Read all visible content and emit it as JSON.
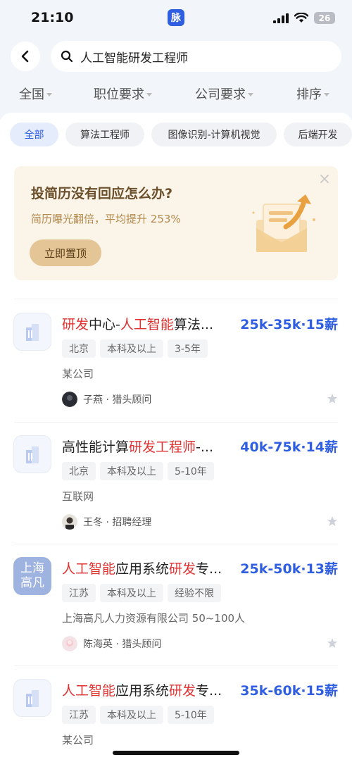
{
  "status_bar": {
    "time": "21:10",
    "app_badge": "脉",
    "battery": "26"
  },
  "search": {
    "query": "人工智能研发工程师"
  },
  "filters": [
    {
      "label": "全国"
    },
    {
      "label": "职位要求"
    },
    {
      "label": "公司要求"
    },
    {
      "label": "排序"
    }
  ],
  "chips": [
    {
      "label": "全部",
      "active": true
    },
    {
      "label": "算法工程师"
    },
    {
      "label": "图像识别-计算机视觉"
    },
    {
      "label": "后端开发"
    }
  ],
  "promo": {
    "title": "投简历没有回应怎么办?",
    "subtitle": "简历曝光翻倍，平均提升 253%",
    "button": "立即置顶"
  },
  "jobs": [
    {
      "title_parts": [
        {
          "t": "研发",
          "hl": true
        },
        {
          "t": "中心-",
          "hl": false
        },
        {
          "t": "人工智能",
          "hl": true
        },
        {
          "t": "算法...",
          "hl": false
        }
      ],
      "salary": "25k-35k·15薪",
      "tags": [
        "北京",
        "本科及以上",
        "3-5年"
      ],
      "company": "某公司",
      "recruiter": "子燕 · 猎头顾问",
      "logo_text": ""
    },
    {
      "title_parts": [
        {
          "t": "高性能计算",
          "hl": false
        },
        {
          "t": "研发工程师",
          "hl": true
        },
        {
          "t": "-...",
          "hl": false
        }
      ],
      "salary": "40k-75k·14薪",
      "tags": [
        "北京",
        "本科及以上",
        "5-10年"
      ],
      "company": "互联网",
      "recruiter": "王冬 · 招聘经理",
      "logo_text": ""
    },
    {
      "title_parts": [
        {
          "t": "人工智能",
          "hl": true
        },
        {
          "t": "应用系统",
          "hl": false
        },
        {
          "t": "研发",
          "hl": true
        },
        {
          "t": "专...",
          "hl": false
        }
      ],
      "salary": "25k-50k·13薪",
      "tags": [
        "江苏",
        "本科及以上",
        "经验不限"
      ],
      "company": "上海高凡人力资源有限公司 50~100人",
      "recruiter": "陈海英 · 猎头顾问",
      "logo_text": "上海高凡"
    },
    {
      "title_parts": [
        {
          "t": "人工智能",
          "hl": true
        },
        {
          "t": "应用系统",
          "hl": false
        },
        {
          "t": "研发",
          "hl": true
        },
        {
          "t": "专...",
          "hl": false
        }
      ],
      "salary": "35k-60k·15薪",
      "tags": [
        "江苏",
        "本科及以上",
        "5-10年"
      ],
      "company": "某公司",
      "recruiter": "",
      "logo_text": ""
    }
  ],
  "colors": {
    "accent": "#2f5ee0",
    "highlight": "#e03131",
    "promo_bg": "#fbf4e8"
  }
}
